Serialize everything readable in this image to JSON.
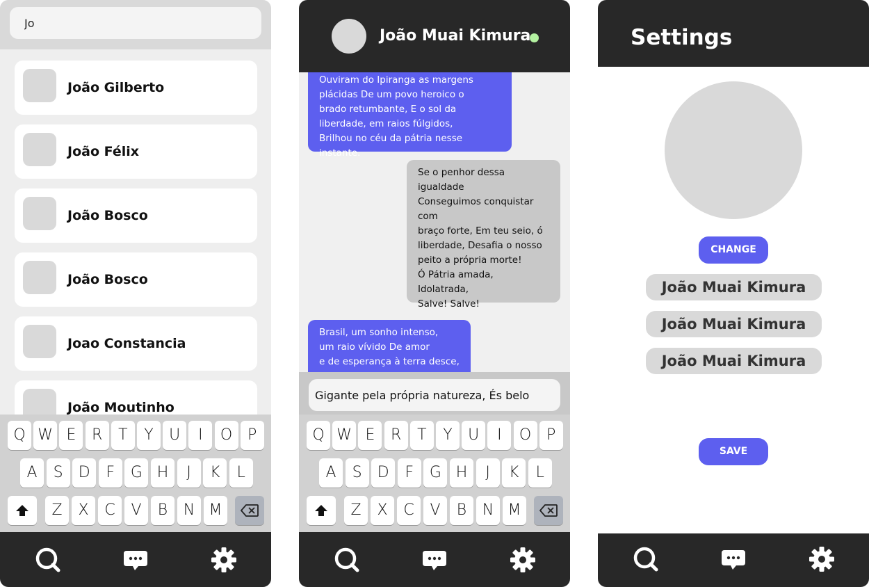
{
  "search_screen": {
    "query": "Jo",
    "results": [
      {
        "name": "João Gilberto"
      },
      {
        "name": "João Félix"
      },
      {
        "name": "João Bosco"
      },
      {
        "name": "João Bosco"
      },
      {
        "name": "Joao Constancia"
      },
      {
        "name": "João Moutinho"
      }
    ]
  },
  "chat_screen": {
    "contact_name": "João Muai Kimura",
    "status": "online",
    "messages": [
      {
        "direction": "incoming",
        "text": "Ouviram do Ipiranga as margens\nplácidas De um povo heroico o\nbrado retumbante, E o sol da\nliberdade, em raios fúlgidos,\nBrilhou no céu da pátria nesse instante."
      },
      {
        "direction": "outgoing",
        "text": "Se o penhor dessa igualdade\nConseguimos conquistar com\nbraço forte, Em teu seio, ó\nliberdade, Desafia o nosso\npeito a própria morte!\nÓ Pátria amada,\nIdolatrada,\nSalve! Salve!"
      },
      {
        "direction": "incoming",
        "text": "Brasil, um sonho intenso,\num raio vívido De amor\ne de esperança à terra desce,"
      }
    ],
    "draft": "Gigante pela própria natureza, És belo"
  },
  "keyboard": {
    "row1": [
      "Q",
      "W",
      "E",
      "R",
      "T",
      "Y",
      "U",
      "I",
      "O",
      "P"
    ],
    "row2": [
      "A",
      "S",
      "D",
      "F",
      "G",
      "H",
      "J",
      "K",
      "L"
    ],
    "row3": [
      "Z",
      "X",
      "C",
      "V",
      "B",
      "N",
      "M"
    ],
    "shift_icon": "shift-arrow-icon",
    "backspace_icon": "backspace-icon"
  },
  "settings_screen": {
    "title": "Settings",
    "change_label": "CHANGE",
    "fields": [
      "João Muai Kimura",
      "João Muai Kimura",
      "João Muai Kimura"
    ],
    "save_label": "SAVE"
  },
  "nav": {
    "items": [
      {
        "icon": "search-icon"
      },
      {
        "icon": "chat-bubble-icon"
      },
      {
        "icon": "gear-icon"
      }
    ]
  },
  "colors": {
    "accent": "#5d5fef",
    "dark": "#282828",
    "online": "#b4f2a1",
    "placeholder_gray": "#d9d9d9"
  }
}
